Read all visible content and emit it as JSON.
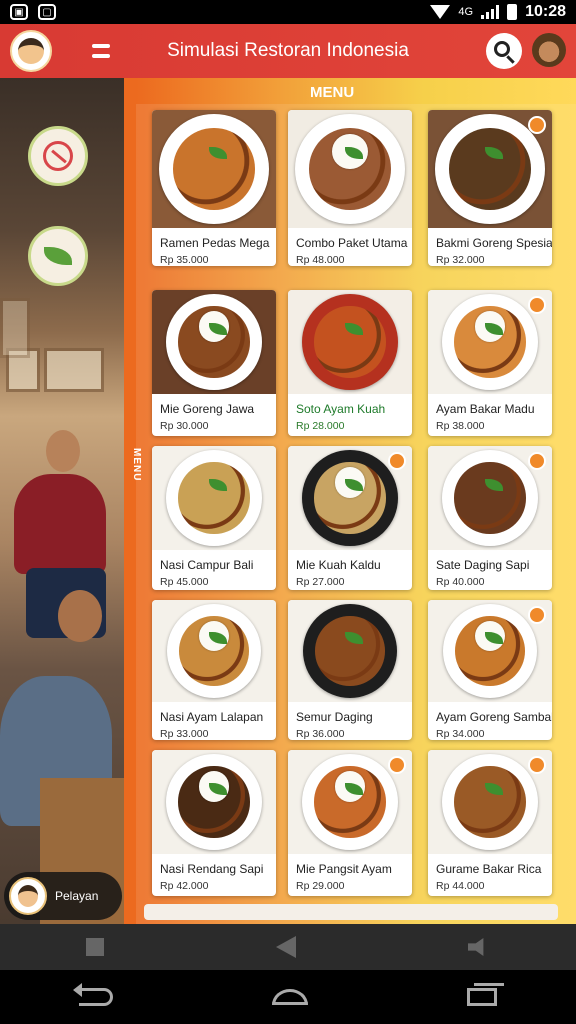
{
  "status_bar": {
    "time": "10:28",
    "network": "4G"
  },
  "app_bar": {
    "title": "Simulasi Restoran Indonesia"
  },
  "menu": {
    "heading": "MENU",
    "side_label": "MENU",
    "items": [
      {
        "name": "Ramen Pedas Mega",
        "price": "Rp 35.000",
        "food_color": "#c9742c",
        "plate": "#ffffff",
        "bg": "#8a5a38"
      },
      {
        "name": "Combo Paket Utama",
        "price": "Rp 48.000",
        "food_color": "#9b5a34",
        "plate": "#ffffff",
        "bg": "#f1ece3"
      },
      {
        "name": "Bakmi Goreng Spesial",
        "price": "Rp 32.000",
        "food_color": "#5a3a1e",
        "plate": "#ffffff",
        "bg": "#7a5236"
      },
      {
        "name": "Mie Goreng Jawa",
        "price": "Rp 30.000",
        "food_color": "#8a4a20",
        "plate": "#ffffff",
        "bg": "#6a4028"
      },
      {
        "name": "Soto Ayam Kuah",
        "price": "Rp 28.000",
        "food_color": "#c4521f",
        "plate": "#b5311f",
        "bg": "#f3eee6"
      },
      {
        "name": "Ayam Bakar Madu",
        "price": "Rp 38.000",
        "food_color": "#d98a3c",
        "plate": "#ffffff",
        "bg": "#f4f1ea"
      },
      {
        "name": "Nasi Campur Bali",
        "price": "Rp 45.000",
        "food_color": "#c9a155",
        "plate": "#ffffff",
        "bg": "#f4f1ea"
      },
      {
        "name": "Mie Kuah Kaldu",
        "price": "Rp 27.000",
        "food_color": "#c8a463",
        "plate": "#1e1e1e",
        "bg": "#f4f1ea"
      },
      {
        "name": "Sate Daging Sapi",
        "price": "Rp 40.000",
        "food_color": "#6a3a1e",
        "plate": "#ffffff",
        "bg": "#f4f1ea"
      },
      {
        "name": "Nasi Ayam Lalapan",
        "price": "Rp 33.000",
        "food_color": "#c98a3c",
        "plate": "#ffffff",
        "bg": "#f4f1ea"
      },
      {
        "name": "Semur Daging",
        "price": "Rp 36.000",
        "food_color": "#8a4a1e",
        "plate": "#1e1e1e",
        "bg": "#f4f1ea"
      },
      {
        "name": "Ayam Goreng Sambal",
        "price": "Rp 34.000",
        "food_color": "#c9792c",
        "plate": "#ffffff",
        "bg": "#f4f1ea"
      },
      {
        "name": "Nasi Rendang Sapi",
        "price": "Rp 42.000",
        "food_color": "#4a2a14",
        "plate": "#ffffff",
        "bg": "#f4f1ea"
      },
      {
        "name": "Mie Pangsit Ayam",
        "price": "Rp 29.000",
        "food_color": "#c96a2a",
        "plate": "#ffffff",
        "bg": "#f4f1ea"
      },
      {
        "name": "Gurame Bakar Rica",
        "price": "Rp 44.000",
        "food_color": "#9a5a26",
        "plate": "#ffffff",
        "bg": "#f4f1ea"
      }
    ]
  },
  "user_chip": {
    "label": "Pelayan"
  },
  "colors": {
    "app_bar": "#d83a33",
    "accent_orange": "#ec6a1f",
    "accent_yellow": "#f6d04a"
  },
  "icons": [
    "logo-icon",
    "menu-toggle-icon",
    "search-icon",
    "profile-avatar",
    "noodle-filter-icon",
    "leaf-filter-icon",
    "back-icon",
    "home-icon",
    "recents-icon"
  ]
}
